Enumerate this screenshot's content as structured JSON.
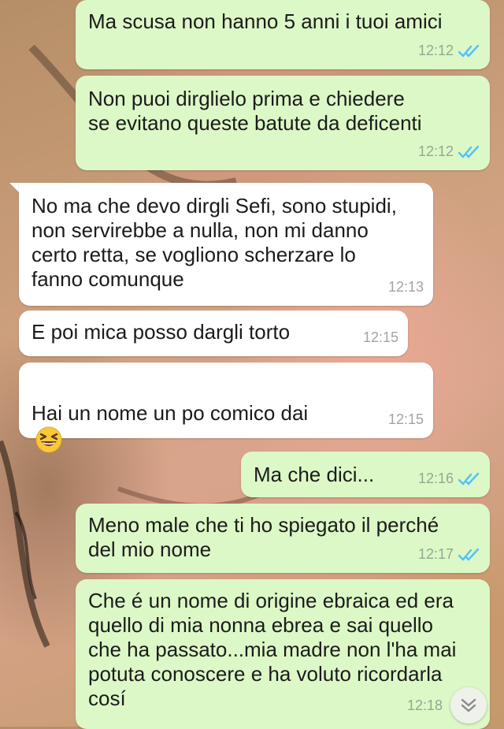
{
  "chat": {
    "messages": [
      {
        "direction": "out",
        "text": "Ma scusa non hanno 5 anni i tuoi amici",
        "time": "12:12",
        "status": "read"
      },
      {
        "direction": "out",
        "text": "Non puoi dirglielo prima e chiedere\nse evitano queste batute da deficenti",
        "time": "12:12",
        "status": "read"
      },
      {
        "direction": "in",
        "text": "No ma che devo dirgli Sefi, sono stupidi,\nnon servirebbe a nulla, non mi danno\ncerto retta, se vogliono scherzare lo\nfanno comunque",
        "time": "12:13"
      },
      {
        "direction": "in",
        "text": "E poi mica posso dargli torto",
        "time": "12:15"
      },
      {
        "direction": "in",
        "text": "Hai un nome un po comico dai",
        "time": "12:15",
        "emoji": "grinning-squinting-face"
      },
      {
        "direction": "out",
        "text": "Ma che dici...",
        "time": "12:16",
        "status": "read"
      },
      {
        "direction": "out",
        "text": "Meno male che ti ho spiegato il perché\ndel mio nome",
        "time": "12:17",
        "status": "read"
      },
      {
        "direction": "out",
        "text": "Che é un nome di origine ebraica ed era\nquello di mia nonna ebrea e sai quello\nche ha passato...mia madre non l'ha mai\npotuta conoscere e ha voluto ricordarla\ncosí",
        "time": "12:18",
        "status": "read"
      }
    ]
  },
  "colors": {
    "outgoing_bubble": "#dcf8c6",
    "incoming_bubble": "#ffffff",
    "read_tick": "#4fc3f7"
  },
  "icons": {
    "read_receipt": "double-check-icon",
    "scroll_down": "chevron-double-down-icon"
  }
}
